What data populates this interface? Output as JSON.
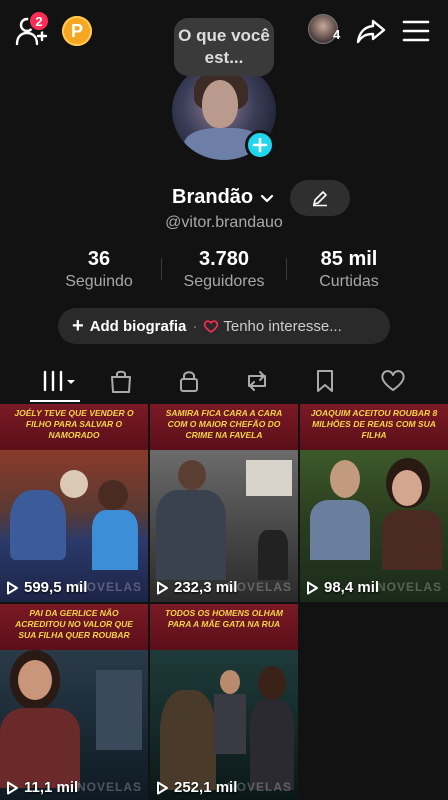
{
  "header": {
    "friend_requests_badge": "2",
    "coin_label": "P",
    "following_avatars_count": "4",
    "note_text": "O que você est..."
  },
  "profile": {
    "name": "Brandão",
    "handle": "@vitor.brandauo"
  },
  "stats": [
    {
      "value": "36",
      "label": "Seguindo"
    },
    {
      "value": "3.780",
      "label": "Seguidores"
    },
    {
      "value": "85 mil",
      "label": "Curtidas"
    }
  ],
  "bio": {
    "add_label": "Add biografia",
    "separator": "·",
    "interest_label": "Tenho interesse..."
  },
  "tabs": [
    {
      "icon": "videos-grid-icon",
      "active": true
    },
    {
      "icon": "shop-bag-icon"
    },
    {
      "icon": "lock-icon"
    },
    {
      "icon": "repost-icon"
    },
    {
      "icon": "bookmark-icon"
    },
    {
      "icon": "heart-icon"
    }
  ],
  "videos": [
    {
      "caption": "Joély teve que vender o filho para salvar o namorado",
      "views": "599,5 mil",
      "watermark": "NOVELAS"
    },
    {
      "caption": "Samira fica cara a cara com o maior chefão do crime na favela",
      "views": "232,3 mil",
      "watermark": "NOVELAS"
    },
    {
      "caption": "Joaquim aceitou roubar 8 milhões de reais com sua filha",
      "views": "98,4 mil",
      "watermark": "NOVELAS"
    },
    {
      "caption": "Pai da Gerlice não acreditou no valor que sua filha quer roubar",
      "views": "11,1 mil",
      "watermark": "NOVELAS"
    },
    {
      "caption": "Todos os homens olham para a mãe gata na rua",
      "views": "252,1 mil",
      "watermark": "NOVELAS"
    }
  ],
  "colors": {
    "background": "#121212",
    "accent_red": "#fe2c55",
    "accent_cyan": "#20d5ec",
    "caption_yellow": "#f5d44b",
    "banner_red": "#7a1a25"
  }
}
